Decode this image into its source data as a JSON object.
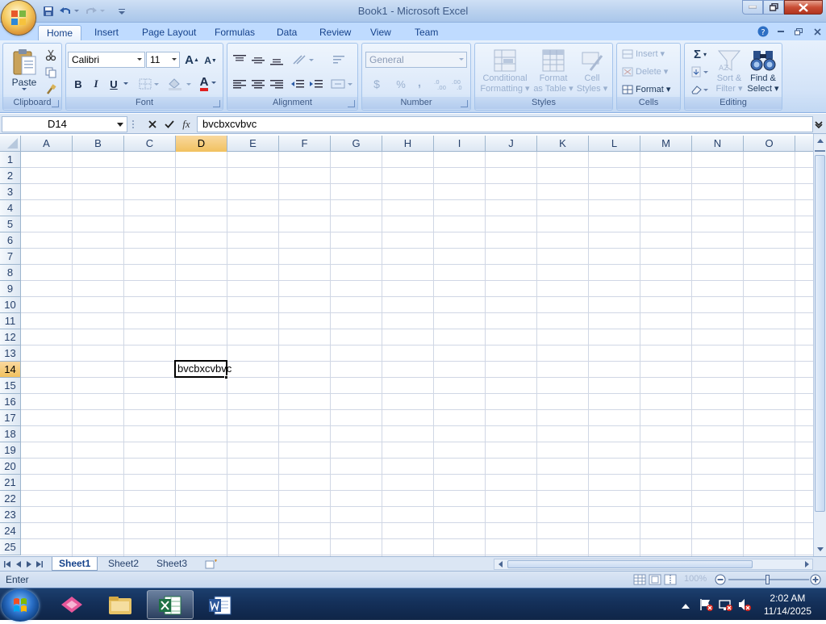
{
  "titlebar": {
    "title": "Book1 - Microsoft Excel"
  },
  "ribbon_tabs": [
    "Home",
    "Insert",
    "Page Layout",
    "Formulas",
    "Data",
    "Review",
    "View",
    "Team"
  ],
  "clipboard": {
    "paste_label": "Paste",
    "group_label": "Clipboard"
  },
  "font": {
    "name": "Calibri",
    "size": "11",
    "bold": "B",
    "italic": "I",
    "underline": "U",
    "grow": "A",
    "shrink": "A",
    "color_letter": "A",
    "group_label": "Font"
  },
  "alignment": {
    "group_label": "Alignment"
  },
  "number": {
    "format": "General",
    "dollar": "$",
    "percent": "%",
    "comma": ",",
    "group_label": "Number"
  },
  "styles": {
    "conditional_1": "Conditional",
    "conditional_2": "Formatting",
    "table_1": "Format",
    "table_2": "as Table",
    "cell_1": "Cell",
    "cell_2": "Styles",
    "group_label": "Styles"
  },
  "cells": {
    "insert": "Insert",
    "delete": "Delete",
    "format": "Format",
    "group_label": "Cells"
  },
  "editing": {
    "sigma": "Σ",
    "sort_1": "Sort &",
    "sort_2": "Filter",
    "find_1": "Find &",
    "find_2": "Select",
    "group_label": "Editing"
  },
  "formula_bar": {
    "name_box": "D14",
    "fx": "fx",
    "content": "bvcbxcvbvc"
  },
  "grid": {
    "columns": [
      "A",
      "B",
      "C",
      "D",
      "E",
      "F",
      "G",
      "H",
      "I",
      "J",
      "K",
      "L",
      "M",
      "N",
      "O"
    ],
    "rows": [
      "1",
      "2",
      "3",
      "4",
      "5",
      "6",
      "7",
      "8",
      "9",
      "10",
      "11",
      "12",
      "13",
      "14",
      "15",
      "16",
      "17",
      "18",
      "19",
      "20",
      "21",
      "22",
      "23",
      "24",
      "25"
    ],
    "selected_column": "D",
    "selected_row": "14",
    "active_cell_value": "bvcbxcvbvc"
  },
  "sheets": [
    "Sheet1",
    "Sheet2",
    "Sheet3"
  ],
  "status": {
    "mode": "Enter",
    "zoom": "100%"
  },
  "taskbar": {
    "time": "2:02 AM",
    "date": "11/14/2025"
  },
  "colors": {
    "accent": "#15428b",
    "selection_header": "#f1c15f",
    "taskbar": "#14305a"
  }
}
